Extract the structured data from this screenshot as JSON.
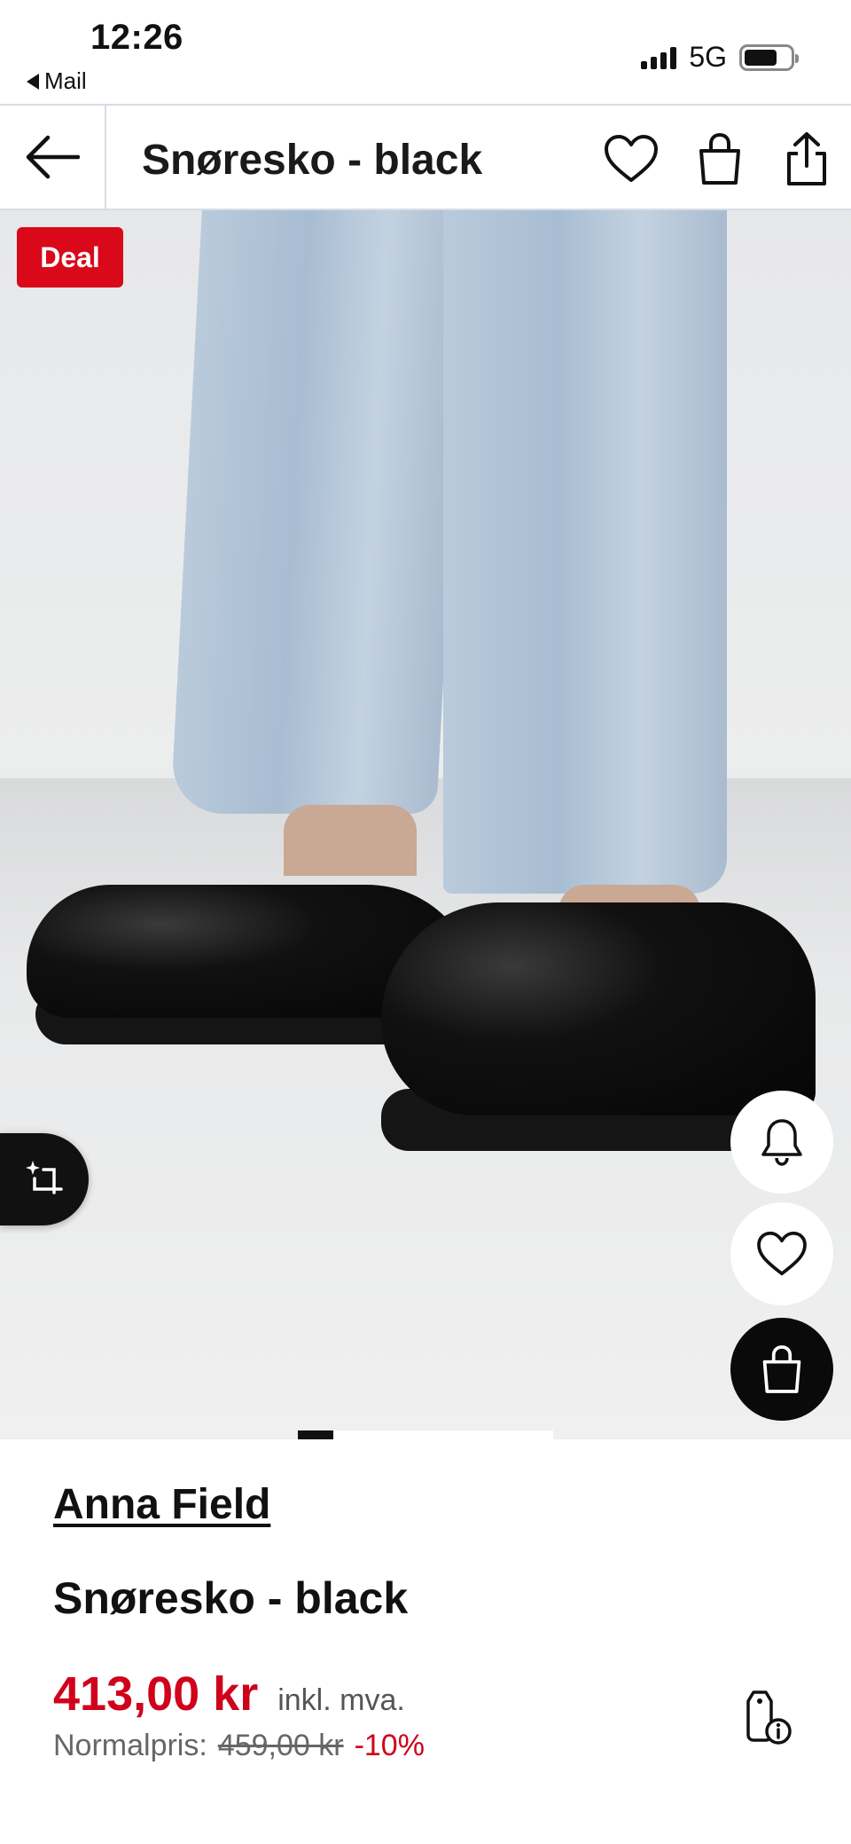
{
  "status_bar": {
    "time": "12:26",
    "back_app": "Mail",
    "network": "5G"
  },
  "header": {
    "title": "Snøresko - black",
    "icons": [
      "back-arrow-icon",
      "heart-icon",
      "bag-icon",
      "share-icon"
    ]
  },
  "gallery": {
    "badge": "Deal",
    "slide_count_indicator": "1 active",
    "floating_buttons": [
      "notification-bell-icon",
      "heart-icon",
      "bag-icon"
    ],
    "ai_button_icon": "sparkle-crop-icon"
  },
  "product": {
    "brand": "Anna Field",
    "name": "Snøresko - black",
    "price": "413,00 kr",
    "vat_note": "inkl. mva.",
    "normal_label": "Normalpris:",
    "normal_price": "459,00 kr",
    "discount": "-10%"
  },
  "colors": {
    "accent_red": "#d0021b",
    "deal_red": "#d9091a",
    "divider": "#d7dde6"
  }
}
